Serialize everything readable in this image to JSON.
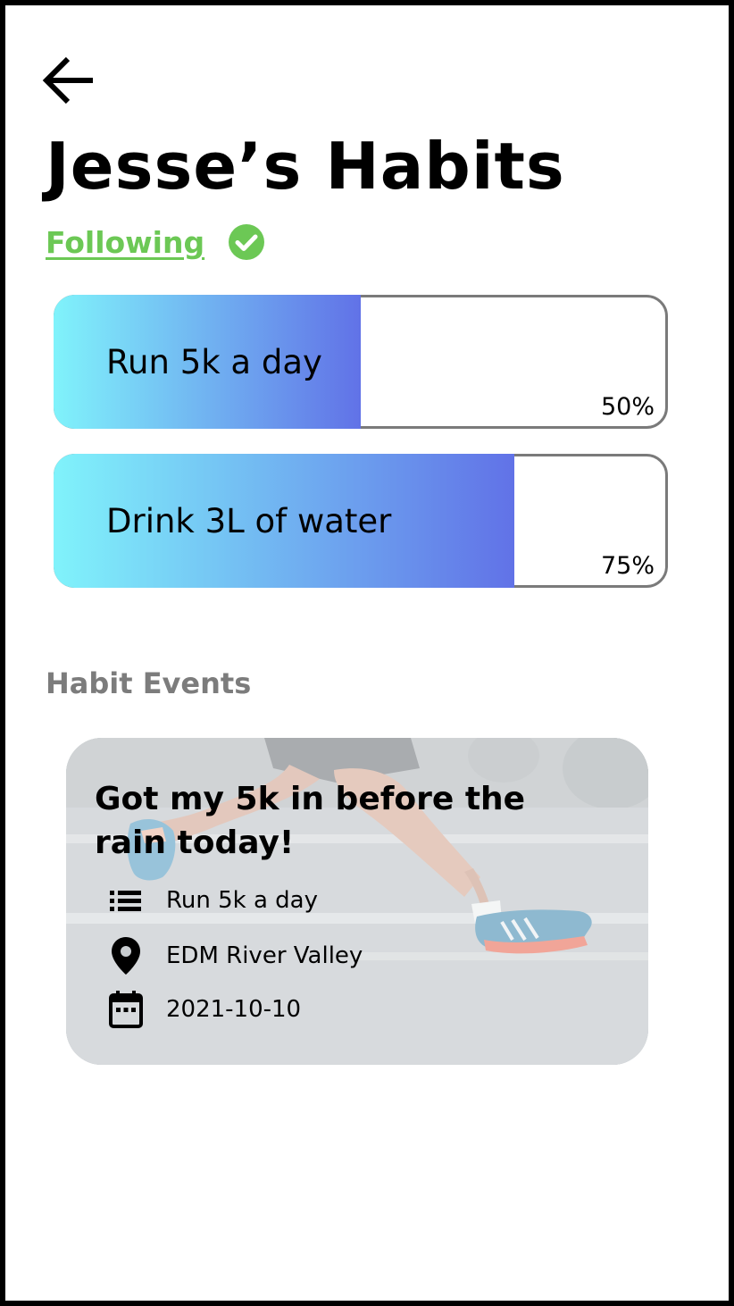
{
  "header": {
    "back_icon": "arrow-left-icon",
    "title": "Jesse’s Habits",
    "following_label": "Following",
    "following_icon": "check-circle-icon",
    "following_color": "#6cc855"
  },
  "habits": [
    {
      "name": "Run 5k a day",
      "progress_label": "50%",
      "progress": 0.5
    },
    {
      "name": "Drink 3L of water",
      "progress_label": "75%",
      "progress": 0.75
    }
  ],
  "habit_bar_gradient": [
    "#80f3fb",
    "#6172e7"
  ],
  "events_section": {
    "title": "Habit Events",
    "events": [
      {
        "title": "Got my 5k in before the rain today!",
        "habit": "Run 5k a day",
        "habit_icon": "list-icon",
        "location": "EDM River Valley",
        "location_icon": "location-pin-icon",
        "date": "2021-10-10",
        "date_icon": "calendar-icon",
        "background": "runner-legs-photo"
      }
    ]
  }
}
